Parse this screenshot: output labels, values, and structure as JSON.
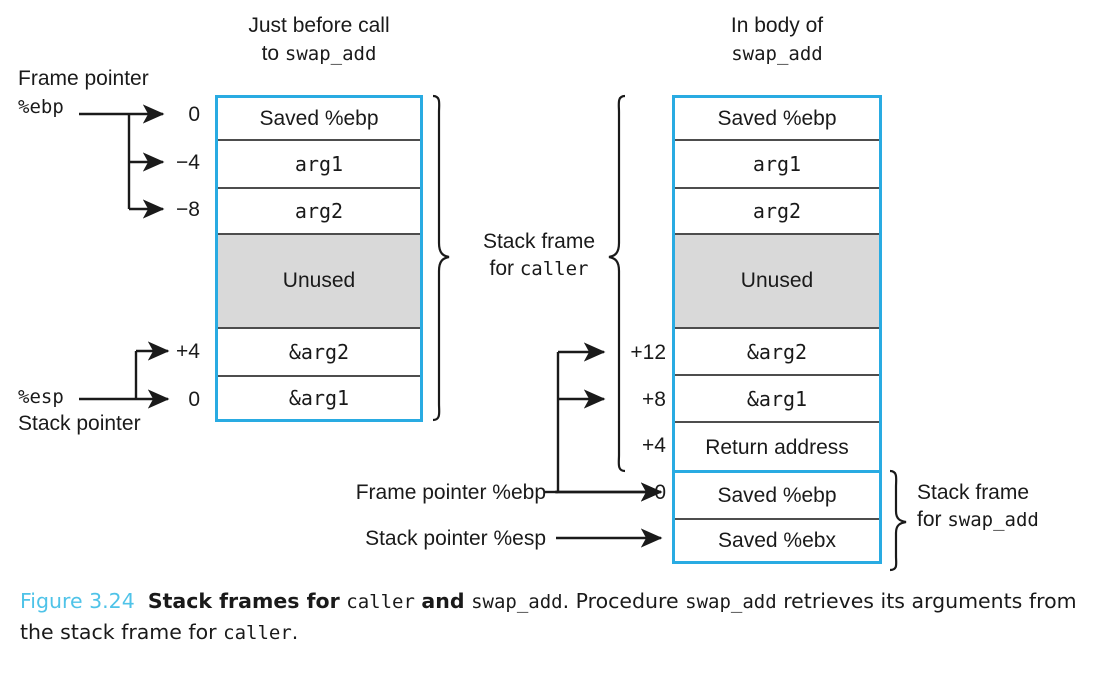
{
  "figure": {
    "number": "Figure 3.24",
    "title_bold_1": "Stack frames for",
    "title_mono_1": "caller",
    "title_bold_2": "and",
    "title_mono_2": "swap_add",
    "body_1": ". Procedure",
    "body_mono_1": "swap_add",
    "body_2": "retrieves its arguments from the stack frame for",
    "body_mono_2": "caller",
    "body_3": ".",
    "accent_color": "#4FC3E8"
  },
  "colors": {
    "box_border_blue": "#29ABE2",
    "cell_divider": "#4d4d4d",
    "unused_fill": "#d9d9d9"
  },
  "left_panel": {
    "header_line1": "Just before call",
    "header_line2_prefix": "to",
    "header_line2_mono": "swap_add",
    "frame_pointer_label_line1": "Frame pointer",
    "frame_pointer_label_line2": "%ebp",
    "stack_pointer_label_line1": "%esp",
    "stack_pointer_label_line2": "Stack pointer",
    "offsets": [
      "0",
      "−4",
      "−8",
      "+4",
      "0"
    ],
    "cells": [
      {
        "text": "Saved %ebp",
        "style": "plain"
      },
      {
        "text": "arg1",
        "style": "mono"
      },
      {
        "text": "arg2",
        "style": "mono"
      },
      {
        "text": "Unused",
        "style": "unused"
      },
      {
        "text": "&arg2",
        "style": "mono"
      },
      {
        "text": "&arg1",
        "style": "mono"
      }
    ]
  },
  "right_panel": {
    "header_line1": "In body of",
    "header_line2_mono": "swap_add",
    "frame_pointer_label": "Frame pointer %ebp",
    "stack_pointer_label": "Stack pointer %esp",
    "offsets": [
      "+12",
      "+8",
      "+4",
      "0"
    ],
    "cells": [
      {
        "text": "Saved %ebp",
        "style": "plain"
      },
      {
        "text": "arg1",
        "style": "mono"
      },
      {
        "text": "arg2",
        "style": "mono"
      },
      {
        "text": "Unused",
        "style": "unused"
      },
      {
        "text": "&arg2",
        "style": "mono"
      },
      {
        "text": "&arg1",
        "style": "mono"
      },
      {
        "text": "Return address",
        "style": "plain"
      },
      {
        "text": "Saved %ebp",
        "style": "plain"
      },
      {
        "text": "Saved %ebx",
        "style": "plain"
      }
    ]
  },
  "braces": {
    "caller_line1": "Stack frame",
    "caller_line2_prefix": "for",
    "caller_line2_mono": "caller",
    "swap_line1": "Stack frame",
    "swap_line2_prefix": "for",
    "swap_line2_mono": "swap_add"
  }
}
